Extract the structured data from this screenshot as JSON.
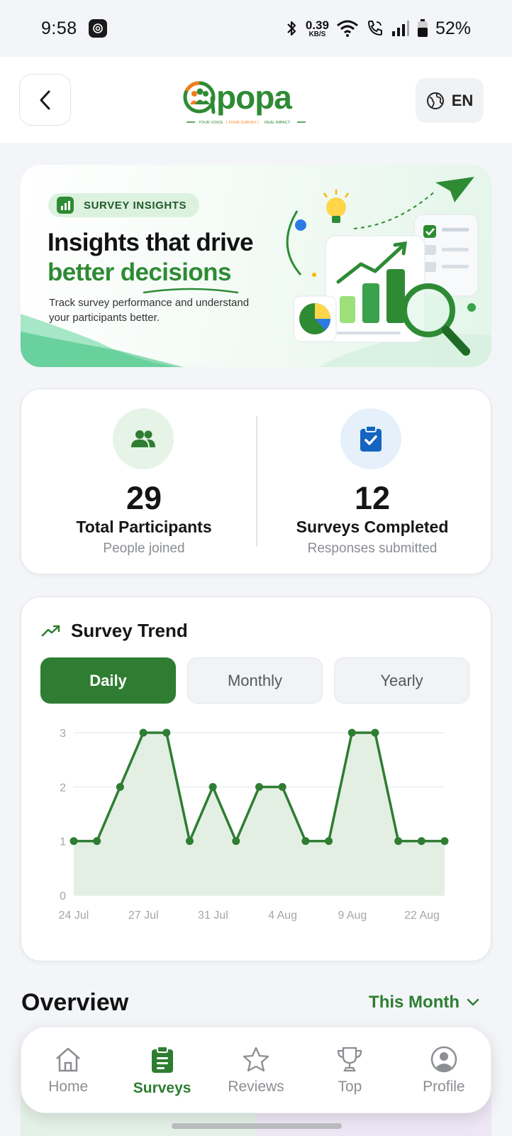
{
  "status_bar": {
    "time": "9:58",
    "net_speed_value": "0.39",
    "net_speed_unit": "KB/S",
    "battery": "52%"
  },
  "header": {
    "logo_text": "apopa",
    "logo_tagline": "— YOUR VOICE | YOUR SURVEY | REAL IMPACT —",
    "language": "EN"
  },
  "hero": {
    "badge": "SURVEY INSIGHTS",
    "title_line1": "Insights that drive",
    "title_line2": "better decisions",
    "subtitle": "Track survey performance and understand your participants better."
  },
  "stats": {
    "participants": {
      "value": "29",
      "label": "Total Participants",
      "sub": "People joined"
    },
    "surveys": {
      "value": "12",
      "label": "Surveys Completed",
      "sub": "Responses submitted"
    }
  },
  "trend": {
    "title": "Survey Trend",
    "tabs": [
      "Daily",
      "Monthly",
      "Yearly"
    ],
    "active_tab": 0
  },
  "chart_data": {
    "type": "area",
    "title": "Survey Trend",
    "xlabel": "",
    "ylabel": "",
    "ylim": [
      0,
      3
    ],
    "yticks": [
      "0",
      "1",
      "2",
      "3"
    ],
    "xtick_labels": [
      "24 Jul",
      "27 Jul",
      "31 Jul",
      "4 Aug",
      "9 Aug",
      "22 Aug"
    ],
    "grid": true,
    "color": "#2e7d32",
    "fill": "#e4efe4",
    "values": [
      1,
      1,
      2,
      3,
      3,
      1,
      2,
      1,
      2,
      2,
      1,
      1,
      3,
      3,
      1,
      1,
      1
    ]
  },
  "overview": {
    "title": "Overview",
    "filter": "This Month"
  },
  "nav": {
    "items": [
      {
        "label": "Home",
        "icon": "home-icon"
      },
      {
        "label": "Surveys",
        "icon": "clipboard-icon"
      },
      {
        "label": "Reviews",
        "icon": "star-icon"
      },
      {
        "label": "Top",
        "icon": "trophy-icon"
      },
      {
        "label": "Profile",
        "icon": "user-circle-icon"
      }
    ],
    "active": 1
  }
}
